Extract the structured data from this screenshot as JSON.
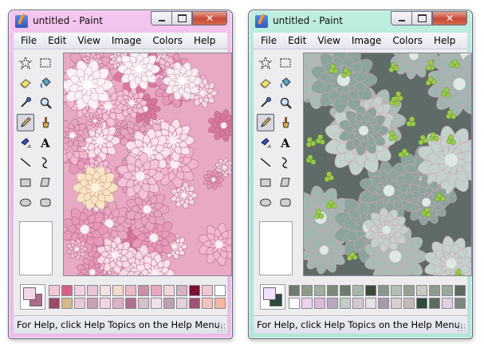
{
  "windows": [
    {
      "id": "left",
      "title": "untitled - Paint",
      "menu": [
        "File",
        "Edit",
        "View",
        "Image",
        "Colors",
        "Help"
      ],
      "status_text": "For Help, click Help Topics on the Help Menu.",
      "theme": {
        "frame": "#eab5e7"
      },
      "foreground_color": "#f2d6e6",
      "background_color": "#b06a8a",
      "palette": [
        "#f4c7d8",
        "#d85f86",
        "#f1d1e1",
        "#e7c4d6",
        "#f5e2dd",
        "#f4d8c8",
        "#e9b8c9",
        "#cc90a6",
        "#e8a8ba",
        "#f3d5d8",
        "#d8b2c0",
        "#7d0f35",
        "#f5c8d5",
        "#ffffff",
        "#9a4a6a",
        "#d6b98a",
        "#e8c8d2",
        "#c9a0b2",
        "#f6d4e0",
        "#e0b0c4",
        "#b07090",
        "#d8c0c8",
        "#f0e0e8",
        "#c0a0b0",
        "#e8d0d8",
        "#a05070",
        "#f3c4b8",
        "#f5b59e"
      ],
      "canvas_theme": "pink-succulents"
    },
    {
      "id": "right",
      "title": "untitled - Paint",
      "menu": [
        "File",
        "Edit",
        "View",
        "Image",
        "Colors",
        "Help"
      ],
      "status_text": "For Help, click Help Topics on the Help Menu.",
      "theme": {
        "frame": "#a7e3d3"
      },
      "foreground_color": "#f2e2ff",
      "background_color": "#2f4a3e",
      "palette": [
        "#6f7a6a",
        "#8c9a86",
        "#a3b0a0",
        "#7c8a7a",
        "#6e7a6c",
        "#a8b8a6",
        "#3c4a3a",
        "#8a9886",
        "#b4c0b4",
        "#96a294",
        "#c8ccc0",
        "#8f9a8c",
        "#9aa896",
        "#5e6a5c",
        "#ffffff",
        "#f0d0f0",
        "#e0b8d8",
        "#b8a8c0",
        "#c0d0c0",
        "#d8c8d0",
        "#e8e0e8",
        "#a898a8",
        "#d8d0d0",
        "#c8b8b8",
        "#2f4a3e",
        "#5a6a5a",
        "#e0d0e0",
        "#7a8a7a"
      ],
      "canvas_theme": "green-succulents"
    }
  ],
  "tools": [
    "free-select-icon",
    "rect-select-icon",
    "eraser-icon",
    "fill-bucket-icon",
    "color-picker-icon",
    "magnifier-icon",
    "pencil-icon",
    "brush-icon",
    "airbrush-icon",
    "text-icon",
    "line-icon",
    "curve-icon",
    "rectangle-icon",
    "polygon-icon",
    "ellipse-icon",
    "rounded-rect-icon"
  ]
}
